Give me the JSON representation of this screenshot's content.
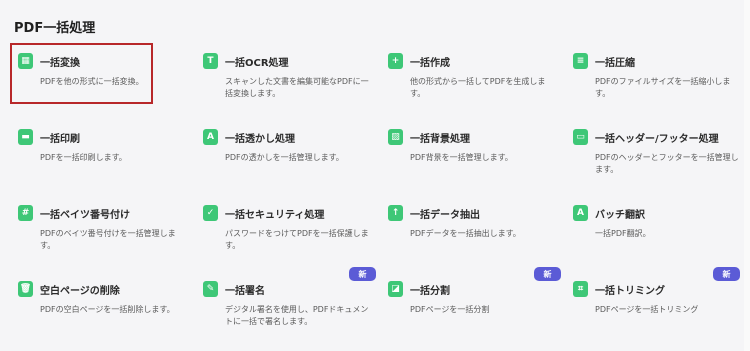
{
  "header": {
    "title": "PDF一括処理"
  },
  "badge_label": "新",
  "colors": {
    "accent": "#3ec777",
    "selected_border": "#b8282a",
    "badge": "#5b5bd6"
  },
  "tools": [
    {
      "title": "一括変換",
      "desc": "PDFを他の形式に一括変換。",
      "icon": "grid-convert-icon",
      "glyph": "▦",
      "badge": false,
      "selected": true
    },
    {
      "title": "一括OCR処理",
      "desc": "スキャンした文書を編集可能なPDFに一括変換します。",
      "icon": "ocr-icon",
      "glyph": "T",
      "badge": false
    },
    {
      "title": "一括作成",
      "desc": "他の形式から一括してPDFを生成します。",
      "icon": "create-icon",
      "glyph": "+",
      "badge": false
    },
    {
      "title": "一括圧縮",
      "desc": "PDFのファイルサイズを一括縮小します。",
      "icon": "compress-icon",
      "glyph": "≡",
      "badge": false
    },
    {
      "title": "一括印刷",
      "desc": "PDFを一括印刷します。",
      "icon": "print-icon",
      "glyph": "▬",
      "badge": false
    },
    {
      "title": "一括透かし処理",
      "desc": "PDFの透かしを一括管理します。",
      "icon": "watermark-icon",
      "glyph": "A",
      "badge": false
    },
    {
      "title": "一括背景処理",
      "desc": "PDF背景を一括管理します。",
      "icon": "background-icon",
      "glyph": "▨",
      "badge": false
    },
    {
      "title": "一括ヘッダー/フッター処理",
      "desc": "PDFのヘッダーとフッターを一括管理します。",
      "icon": "header-footer-icon",
      "glyph": "▭",
      "badge": false
    },
    {
      "title": "一括ベイツ番号付け",
      "desc": "PDFのベイツ番号付けを一括管理します。",
      "icon": "bates-number-icon",
      "glyph": "#",
      "badge": false
    },
    {
      "title": "一括セキュリティ処理",
      "desc": "パスワードをつけてPDFを一括保護します。",
      "icon": "shield-icon",
      "glyph": "✓",
      "badge": false
    },
    {
      "title": "一括データ抽出",
      "desc": "PDFデータを一括抽出します。",
      "icon": "extract-icon",
      "glyph": "↑",
      "badge": false
    },
    {
      "title": "バッチ翻訳",
      "desc": "一括PDF翻訳。",
      "icon": "translate-icon",
      "glyph": "A",
      "badge": false
    },
    {
      "title": "空白ページの削除",
      "desc": "PDFの空白ページを一括削除します。",
      "icon": "trash-icon",
      "glyph": "🗑",
      "badge": false
    },
    {
      "title": "一括署名",
      "desc": "デジタル署名を使用し、PDFドキュメントに一括で署名します。",
      "icon": "signature-icon",
      "glyph": "✎",
      "badge": true
    },
    {
      "title": "一括分割",
      "desc": "PDFページを一括分割",
      "icon": "split-icon",
      "glyph": "◪",
      "badge": true
    },
    {
      "title": "一括トリミング",
      "desc": "PDFページを一括トリミング",
      "icon": "crop-icon",
      "glyph": "⌗",
      "badge": true
    }
  ]
}
